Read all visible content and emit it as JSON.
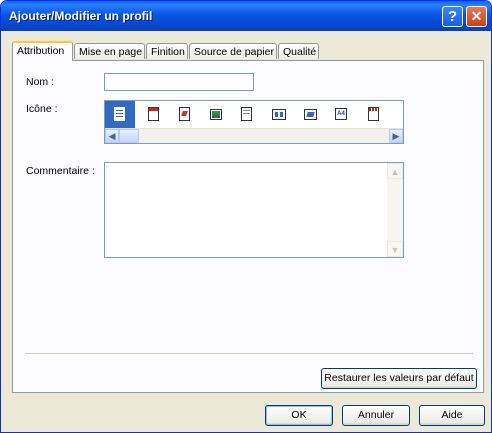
{
  "window": {
    "title": "Ajouter/Modifier un profil",
    "help_glyph": "?",
    "close_glyph": "✕"
  },
  "tabs": [
    {
      "label": "Attribution",
      "active": true
    },
    {
      "label": "Mise en page",
      "active": false
    },
    {
      "label": "Finition",
      "active": false
    },
    {
      "label": "Source de papier",
      "active": false
    },
    {
      "label": "Qualité",
      "active": false
    }
  ],
  "form": {
    "nom_label": "Nom :",
    "nom_value": "",
    "icone_label": "Icône :",
    "commentaire_label": "Commentaire :",
    "commentaire_value": ""
  },
  "icons": [
    "document-icon-selected",
    "document-red-header-icon",
    "document-redbar-icon",
    "document-image-icon",
    "document-stack-icon",
    "document-columns-icon",
    "document-folded-icon",
    "document-a4-icon",
    "document-red-top-icon"
  ],
  "buttons": {
    "restore": "Restaurer les valeurs par défaut",
    "ok": "OK",
    "cancel": "Annuler",
    "help": "Aide"
  },
  "colors": {
    "title_bar": "#0a56e6",
    "selection": "#316ac5",
    "tab_highlight": "#ffc73c"
  }
}
